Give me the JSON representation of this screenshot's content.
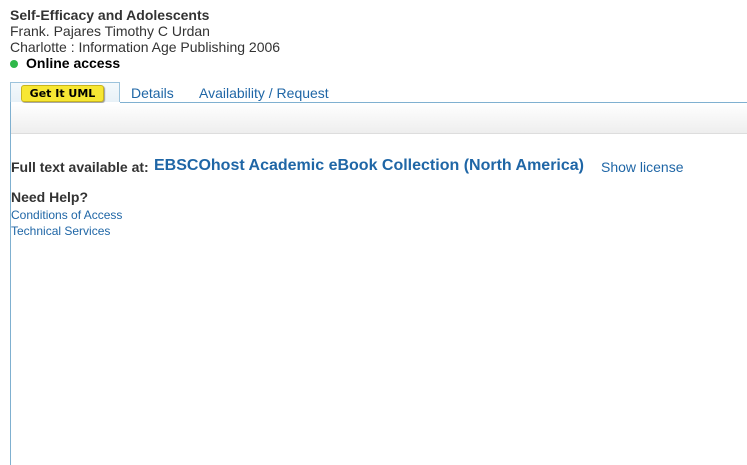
{
  "record": {
    "title": "Self-Efficacy and Adolescents",
    "authors": "Frank. Pajares Timothy C Urdan",
    "publisher": "Charlotte : Information Age Publishing 2006",
    "availability_status": "Online access",
    "status_color": "#2fb84a"
  },
  "tabs": {
    "getit_label": "Get It UML",
    "details_label": "Details",
    "availability_label": "Availability / Request"
  },
  "fulltext": {
    "label": "Full text available at:",
    "collection": "EBSCOhost Academic eBook Collection (North America)",
    "license_link": "Show license"
  },
  "help": {
    "heading": "Need Help?",
    "links": [
      "Conditions of Access",
      "Technical Services"
    ]
  },
  "colors": {
    "link": "#1f66a6",
    "badge_yellow": "#f7e733",
    "tab_border": "#7fb0d0"
  },
  "icons": {
    "status": "green-dot-icon"
  }
}
